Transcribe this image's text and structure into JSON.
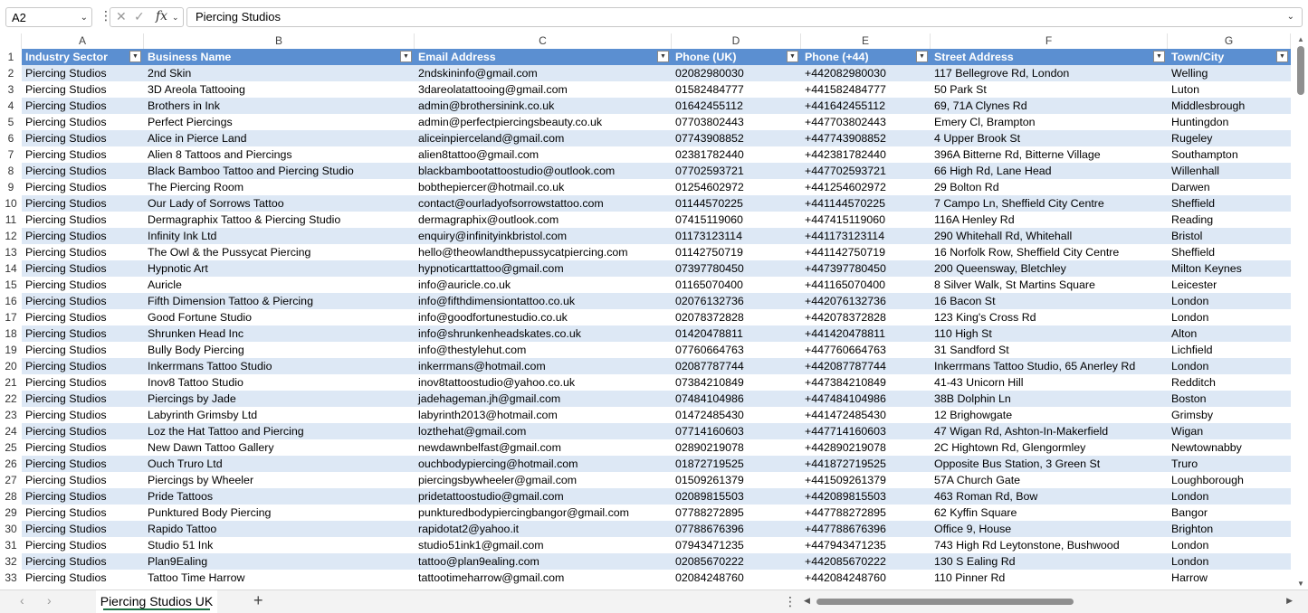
{
  "formula_bar": {
    "name_box": "A2",
    "formula_value": "Piercing Studios"
  },
  "column_letters": [
    "A",
    "B",
    "C",
    "D",
    "E",
    "F",
    "G"
  ],
  "headers": [
    "Industry Sector",
    "Business Name",
    "Email Address",
    "Phone (UK)",
    "Phone (+44)",
    "Street Address",
    "Town/City"
  ],
  "rows": [
    [
      "Piercing Studios",
      "2nd Skin",
      "2ndskininfo@gmail.com",
      "02082980030",
      "+442082980030",
      "117 Bellegrove Rd, London",
      "Welling"
    ],
    [
      "Piercing Studios",
      "3D Areola Tattooing",
      "3dareolatattooing@gmail.com",
      "01582484777",
      "+441582484777",
      "50 Park St",
      "Luton"
    ],
    [
      "Piercing Studios",
      "Brothers in Ink",
      "admin@brothersinink.co.uk",
      "01642455112",
      "+441642455112",
      "69, 71A Clynes Rd",
      "Middlesbrough"
    ],
    [
      "Piercing Studios",
      "Perfect Piercings",
      "admin@perfectpiercingsbeauty.co.uk",
      "07703802443",
      "+447703802443",
      "Emery Cl, Brampton",
      "Huntingdon"
    ],
    [
      "Piercing Studios",
      "Alice in Pierce Land",
      "aliceinpierceland@gmail.com",
      "07743908852",
      "+447743908852",
      "4 Upper Brook St",
      "Rugeley"
    ],
    [
      "Piercing Studios",
      "Alien 8 Tattoos and Piercings",
      "alien8tattoo@gmail.com",
      "02381782440",
      "+442381782440",
      "396A Bitterne Rd, Bitterne Village",
      "Southampton"
    ],
    [
      "Piercing Studios",
      "Black Bamboo Tattoo and Piercing Studio",
      "blackbambootattoostudio@outlook.com",
      "07702593721",
      "+447702593721",
      "66 High Rd, Lane Head",
      "Willenhall"
    ],
    [
      "Piercing Studios",
      "The Piercing Room",
      "bobthepiercer@hotmail.co.uk",
      "01254602972",
      "+441254602972",
      "29 Bolton Rd",
      "Darwen"
    ],
    [
      "Piercing Studios",
      "Our Lady of Sorrows Tattoo",
      "contact@ourladyofsorrowstattoo.com",
      "01144570225",
      "+441144570225",
      "7 Campo Ln, Sheffield City Centre",
      "Sheffield"
    ],
    [
      "Piercing Studios",
      "Dermagraphix Tattoo & Piercing Studio",
      "dermagraphix@outlook.com",
      "07415119060",
      "+447415119060",
      "116A Henley Rd",
      "Reading"
    ],
    [
      "Piercing Studios",
      "Infinity Ink Ltd",
      "enquiry@infinityinkbristol.com",
      "01173123114",
      "+441173123114",
      "290 Whitehall Rd, Whitehall",
      "Bristol"
    ],
    [
      "Piercing Studios",
      "The Owl & the Pussycat Piercing",
      "hello@theowlandthepussycatpiercing.com",
      "01142750719",
      "+441142750719",
      "16 Norfolk Row, Sheffield City Centre",
      "Sheffield"
    ],
    [
      "Piercing Studios",
      "Hypnotic Art",
      "hypnoticarttattoo@gmail.com",
      "07397780450",
      "+447397780450",
      "200 Queensway, Bletchley",
      "Milton Keynes"
    ],
    [
      "Piercing Studios",
      "Auricle",
      "info@auricle.co.uk",
      "01165070400",
      "+441165070400",
      "8 Silver Walk, St Martins Square",
      "Leicester"
    ],
    [
      "Piercing Studios",
      "Fifth Dimension Tattoo & Piercing",
      "info@fifthdimensiontattoo.co.uk",
      "02076132736",
      "+442076132736",
      "16 Bacon St",
      "London"
    ],
    [
      "Piercing Studios",
      "Good Fortune Studio",
      "info@goodfortunestudio.co.uk",
      "02078372828",
      "+442078372828",
      "123 King's Cross Rd",
      "London"
    ],
    [
      "Piercing Studios",
      "Shrunken Head Inc",
      "info@shrunkenheadskates.co.uk",
      "01420478811",
      "+441420478811",
      "110 High St",
      "Alton"
    ],
    [
      "Piercing Studios",
      "Bully Body Piercing",
      "info@thestylehut.com",
      "07760664763",
      "+447760664763",
      "31 Sandford St",
      "Lichfield"
    ],
    [
      "Piercing Studios",
      "Inkerrmans Tattoo Studio",
      "inkerrmans@hotmail.com",
      "02087787744",
      "+442087787744",
      "Inkerrmans Tattoo Studio, 65 Anerley Rd",
      "London"
    ],
    [
      "Piercing Studios",
      "Inov8 Tattoo Studio",
      "inov8tattoostudio@yahoo.co.uk",
      "07384210849",
      "+447384210849",
      "41-43 Unicorn Hill",
      "Redditch"
    ],
    [
      "Piercing Studios",
      "Piercings by Jade",
      "jadehageman.jh@gmail.com",
      "07484104986",
      "+447484104986",
      "38B Dolphin Ln",
      "Boston"
    ],
    [
      "Piercing Studios",
      "Labyrinth Grimsby Ltd",
      "labyrinth2013@hotmail.com",
      "01472485430",
      "+441472485430",
      "12 Brighowgate",
      "Grimsby"
    ],
    [
      "Piercing Studios",
      "Loz the Hat Tattoo and Piercing",
      "lozthehat@gmail.com",
      "07714160603",
      "+447714160603",
      "47 Wigan Rd, Ashton-In-Makerfield",
      "Wigan"
    ],
    [
      "Piercing Studios",
      "New Dawn Tattoo Gallery",
      "newdawnbelfast@gmail.com",
      "02890219078",
      "+442890219078",
      "2C Hightown Rd, Glengormley",
      "Newtownabby"
    ],
    [
      "Piercing Studios",
      "Ouch Truro Ltd",
      "ouchbodypiercing@hotmail.com",
      "01872719525",
      "+441872719525",
      "Opposite Bus Station, 3 Green St",
      "Truro"
    ],
    [
      "Piercing Studios",
      "Piercings by Wheeler",
      "piercingsbywheeler@gmail.com",
      "01509261379",
      "+441509261379",
      "57A Church Gate",
      "Loughborough"
    ],
    [
      "Piercing Studios",
      "Pride Tattoos",
      "pridetattoostudio@gmail.com",
      "02089815503",
      "+442089815503",
      "463 Roman Rd, Bow",
      "London"
    ],
    [
      "Piercing Studios",
      "Punktured Body Piercing",
      "punkturedbodypiercingbangor@gmail.com",
      "07788272895",
      "+447788272895",
      "62 Kyffin Square",
      "Bangor"
    ],
    [
      "Piercing Studios",
      "Rapido Tattoo",
      "rapidotat2@yahoo.it",
      "07788676396",
      "+447788676396",
      "Office 9, House",
      "Brighton"
    ],
    [
      "Piercing Studios",
      "Studio 51 Ink",
      "studio51ink1@gmail.com",
      "07943471235",
      "+447943471235",
      "743 High Rd Leytonstone, Bushwood",
      "London"
    ],
    [
      "Piercing Studios",
      "Plan9Ealing",
      "tattoo@plan9ealing.com",
      "02085670222",
      "+442085670222",
      "130 S Ealing Rd",
      "London"
    ],
    [
      "Piercing Studios",
      "Tattoo Time Harrow",
      "tattootimeharrow@gmail.com",
      "02084248760",
      "+442084248760",
      "110 Pinner Rd",
      "Harrow"
    ]
  ],
  "sheet_tab": "Piercing Studios UK",
  "colors": {
    "header_bg": "#5b8fd1",
    "band": "#dde8f5",
    "tab_underline": "#1e7145"
  },
  "icons": {
    "cancel": "cancel-x-icon",
    "confirm": "check-icon",
    "function": "fx-icon",
    "add_sheet": "plus-icon"
  }
}
